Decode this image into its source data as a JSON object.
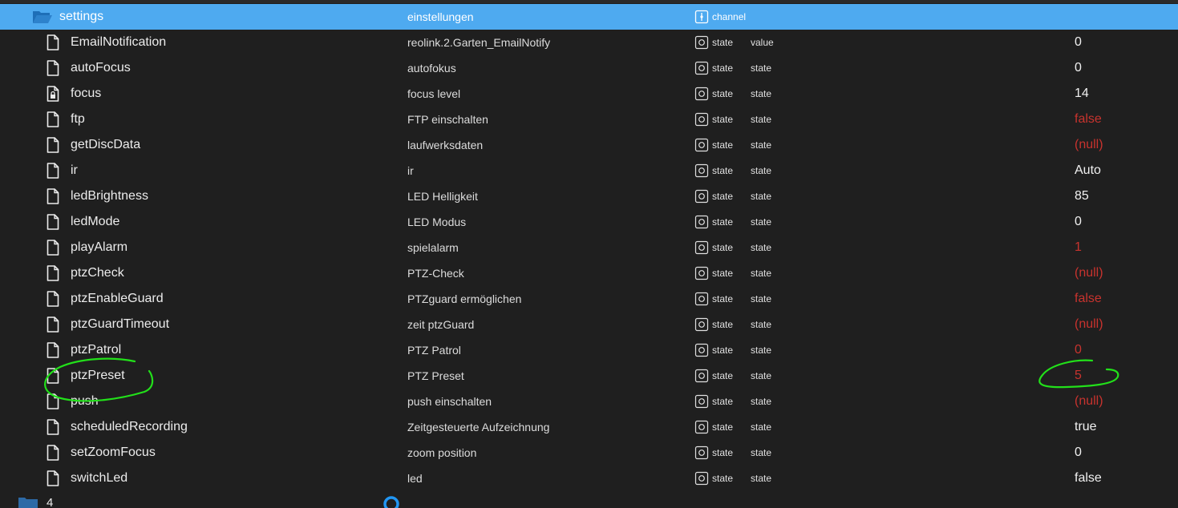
{
  "folder": {
    "name": "settings",
    "description": "einstellungen",
    "type": "channel",
    "icon": "folder-open-icon",
    "type_icon": "channel-icon"
  },
  "rows": [
    {
      "name": "EmailNotification",
      "desc": "reolink.2.Garten_EmailNotify",
      "type": "state",
      "role": "value",
      "value": "0",
      "value_color": "normal",
      "icon": "file-icon"
    },
    {
      "name": "autoFocus",
      "desc": "autofokus",
      "type": "state",
      "role": "state",
      "value": "0",
      "value_color": "normal",
      "icon": "file-icon"
    },
    {
      "name": "focus",
      "desc": "focus level",
      "type": "state",
      "role": "state",
      "value": "14",
      "value_color": "normal",
      "icon": "file-locked-icon"
    },
    {
      "name": "ftp",
      "desc": "FTP einschalten",
      "type": "state",
      "role": "state",
      "value": "false",
      "value_color": "red",
      "icon": "file-icon"
    },
    {
      "name": "getDiscData",
      "desc": "laufwerksdaten",
      "type": "state",
      "role": "state",
      "value": "(null)",
      "value_color": "red",
      "icon": "file-icon"
    },
    {
      "name": "ir",
      "desc": "ir",
      "type": "state",
      "role": "state",
      "value": "Auto",
      "value_color": "normal",
      "icon": "file-icon"
    },
    {
      "name": "ledBrightness",
      "desc": "LED Helligkeit",
      "type": "state",
      "role": "state",
      "value": "85",
      "value_color": "normal",
      "icon": "file-icon"
    },
    {
      "name": "ledMode",
      "desc": "LED Modus",
      "type": "state",
      "role": "state",
      "value": "0",
      "value_color": "normal",
      "icon": "file-icon"
    },
    {
      "name": "playAlarm",
      "desc": "spielalarm",
      "type": "state",
      "role": "state",
      "value": "1",
      "value_color": "red",
      "icon": "file-icon"
    },
    {
      "name": "ptzCheck",
      "desc": "PTZ-Check",
      "type": "state",
      "role": "state",
      "value": "(null)",
      "value_color": "red",
      "icon": "file-icon"
    },
    {
      "name": "ptzEnableGuard",
      "desc": "PTZguard ermöglichen",
      "type": "state",
      "role": "state",
      "value": "false",
      "value_color": "red",
      "icon": "file-icon"
    },
    {
      "name": "ptzGuardTimeout",
      "desc": "zeit ptzGuard",
      "type": "state",
      "role": "state",
      "value": "(null)",
      "value_color": "red",
      "icon": "file-icon"
    },
    {
      "name": "ptzPatrol",
      "desc": "PTZ Patrol",
      "type": "state",
      "role": "state",
      "value": "0",
      "value_color": "red",
      "icon": "file-icon"
    },
    {
      "name": "ptzPreset",
      "desc": "PTZ Preset",
      "type": "state",
      "role": "state",
      "value": "5",
      "value_color": "red",
      "icon": "file-icon"
    },
    {
      "name": "push",
      "desc": "push einschalten",
      "type": "state",
      "role": "state",
      "value": "(null)",
      "value_color": "red",
      "icon": "file-icon"
    },
    {
      "name": "scheduledRecording",
      "desc": "Zeitgesteuerte Aufzeichnung",
      "type": "state",
      "role": "state",
      "value": "true",
      "value_color": "normal",
      "icon": "file-icon"
    },
    {
      "name": "setZoomFocus",
      "desc": "zoom position",
      "type": "state",
      "role": "state",
      "value": "0",
      "value_color": "normal",
      "icon": "file-icon"
    },
    {
      "name": "switchLed",
      "desc": "led",
      "type": "state",
      "role": "state",
      "value": "false",
      "value_color": "normal",
      "icon": "file-icon"
    }
  ],
  "bottom": {
    "folder_label": "4",
    "folder_icon": "folder-icon",
    "status_icon": "circle-icon"
  },
  "colors": {
    "background": "#1f1f1f",
    "selected_row": "#4eaaf0",
    "red_value": "#c8332e",
    "annotation": "#22e01a"
  }
}
